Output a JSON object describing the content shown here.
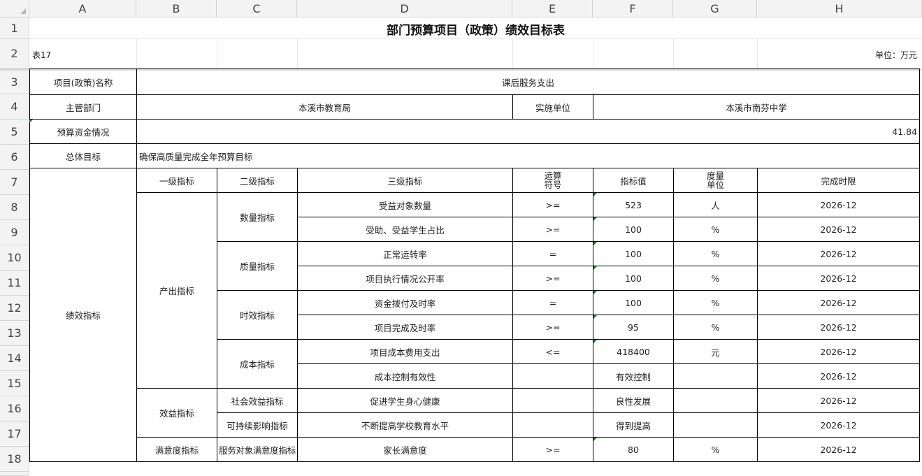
{
  "columns": [
    "A",
    "B",
    "C",
    "D",
    "E",
    "F",
    "G",
    "H"
  ],
  "rows": [
    "1",
    "2",
    "3",
    "4",
    "5",
    "6",
    "7",
    "8",
    "9",
    "10",
    "11",
    "12",
    "13",
    "14",
    "15",
    "16",
    "17",
    "18"
  ],
  "title": "部门预算项目（政策）绩效目标表",
  "table_no": "表17",
  "unit_label": "单位：万元",
  "project_name_label": "项目(政策)名称",
  "project_name": "课后服务支出",
  "dept_label": "主管部门",
  "dept": "本溪市教育局",
  "impl_label": "实施单位",
  "impl": "本溪市南芬中学",
  "budget_label": "预算资金情况",
  "budget": "41.84",
  "goal_label": "总体目标",
  "goal": "确保高质量完成全年预算目标",
  "perf_label": "绩效指标",
  "headers": {
    "l1": "一级指标",
    "l2": "二级指标",
    "l3": "三级指标",
    "op1": "运算",
    "op2": "符号",
    "value": "指标值",
    "unit1": "度量",
    "unit2": "单位",
    "deadline": "完成时限"
  },
  "level1": {
    "output": "产出指标",
    "benefit": "效益指标",
    "satisfaction": "满意度指标"
  },
  "level2": {
    "quantity": "数量指标",
    "quality": "质量指标",
    "timeliness": "时效指标",
    "cost": "成本指标",
    "social": "社会效益指标",
    "sustain": "可持续影响指标",
    "service": "服务对象满意度指标"
  },
  "indicators": [
    {
      "name": "受益对象数量",
      "op": ">=",
      "value": "523",
      "unit": "人",
      "deadline": "2026-12"
    },
    {
      "name": "受助、受益学生占比",
      "op": ">=",
      "value": "100",
      "unit": "%",
      "deadline": "2026-12"
    },
    {
      "name": "正常运转率",
      "op": "=",
      "value": "100",
      "unit": "%",
      "deadline": "2026-12"
    },
    {
      "name": "项目执行情况公开率",
      "op": ">=",
      "value": "100",
      "unit": "%",
      "deadline": "2026-12"
    },
    {
      "name": "资金拨付及时率",
      "op": "=",
      "value": "100",
      "unit": "%",
      "deadline": "2026-12"
    },
    {
      "name": "项目完成及时率",
      "op": ">=",
      "value": "95",
      "unit": "%",
      "deadline": "2026-12"
    },
    {
      "name": "项目成本费用支出",
      "op": "<=",
      "value": "418400",
      "unit": "元",
      "deadline": "2026-12"
    },
    {
      "name": "成本控制有效性",
      "op": "",
      "value": "有效控制",
      "unit": "",
      "deadline": "2026-12"
    },
    {
      "name": "促进学生身心健康",
      "op": "",
      "value": "良性发展",
      "unit": "",
      "deadline": "2026-12"
    },
    {
      "name": "不断提高学校教育水平",
      "op": "",
      "value": "得到提高",
      "unit": "",
      "deadline": "2026-12"
    },
    {
      "name": "家长满意度",
      "op": ">=",
      "value": "80",
      "unit": "%",
      "deadline": "2026-12"
    }
  ]
}
